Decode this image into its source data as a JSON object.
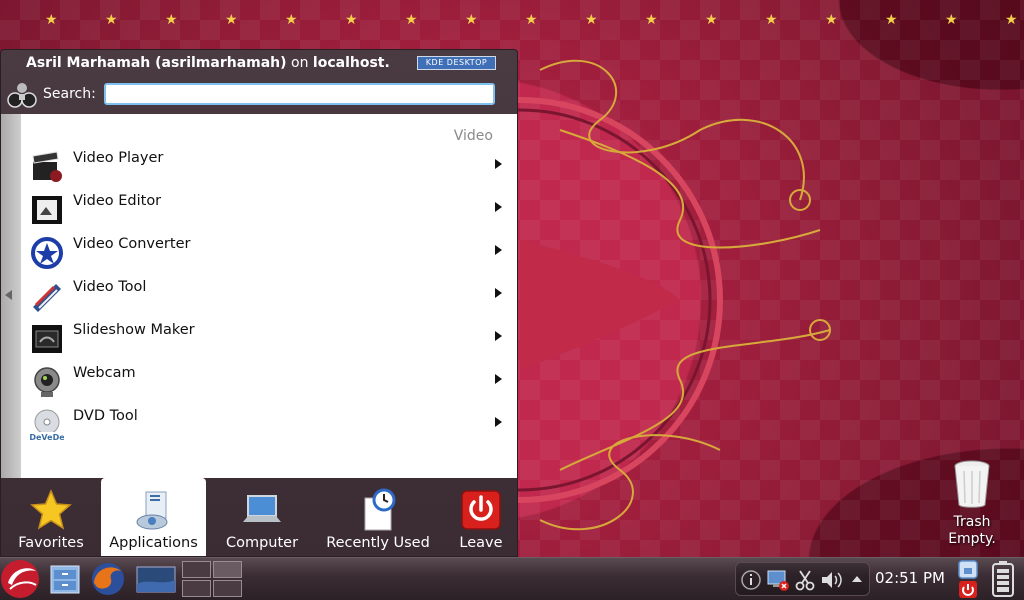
{
  "header": {
    "user_name": "Asril Marhamah (asrilmarhamah)",
    "on_text": " on ",
    "host": "localhost.",
    "kde_badge": "KDE DESKTOP"
  },
  "search": {
    "label": "Search:",
    "value": "",
    "placeholder": ""
  },
  "breadcrumb": "Video",
  "apps": [
    {
      "label": "Video Player",
      "icon": "clapperboard-icon"
    },
    {
      "label": "Video Editor",
      "icon": "film-editor-icon"
    },
    {
      "label": "Video Converter",
      "icon": "converter-icon"
    },
    {
      "label": "Video Tool",
      "icon": "film-strip-icon"
    },
    {
      "label": "Slideshow Maker",
      "icon": "slideshow-icon"
    },
    {
      "label": "Webcam",
      "icon": "webcam-icon"
    },
    {
      "label": "DVD Tool",
      "icon": "dvd-icon"
    }
  ],
  "tabs": [
    {
      "label": "Favorites",
      "icon": "star-icon"
    },
    {
      "label": "Applications",
      "icon": "applications-icon",
      "active": true
    },
    {
      "label": "Computer",
      "icon": "laptop-icon"
    },
    {
      "label": "Recently Used",
      "icon": "clock-document-icon"
    },
    {
      "label": "Leave",
      "icon": "power-icon"
    }
  ],
  "desktop": {
    "trash_label": "Trash",
    "trash_status": "Empty."
  },
  "taskbar": {
    "clock": "02:51 PM"
  },
  "colors": {
    "wallpaper": "#a31f3e",
    "menu_bg": "#45353d",
    "search_border": "#7ec0ee",
    "star_gold": "#f3d04a"
  }
}
